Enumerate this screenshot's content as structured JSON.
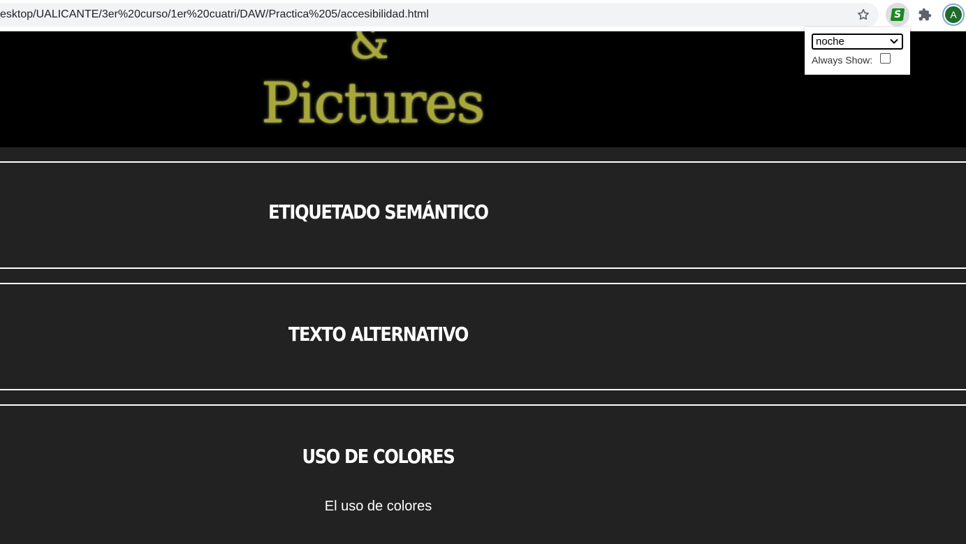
{
  "browser": {
    "url": "esktop/UALICANTE/3er%20curso/1er%20cuatri/DAW/Practica%205/accesibilidad.html",
    "extension_letter": "S",
    "profile_initial": "A"
  },
  "popup": {
    "selected_option": "noche",
    "always_show_label": "Always Show:",
    "always_show_checked": false
  },
  "header": {
    "logo_ampersand": "&",
    "logo_word": "Pictures",
    "logo_color": "#a8a83a"
  },
  "sections": [
    {
      "title": "Etiquetado semántico"
    },
    {
      "title": "Texto alternativo"
    },
    {
      "title": "Uso de colores",
      "text": "El uso de colores"
    }
  ],
  "colors": {
    "page_background": "#222222",
    "banner_background": "#000000",
    "section_border": "#ffffff"
  }
}
